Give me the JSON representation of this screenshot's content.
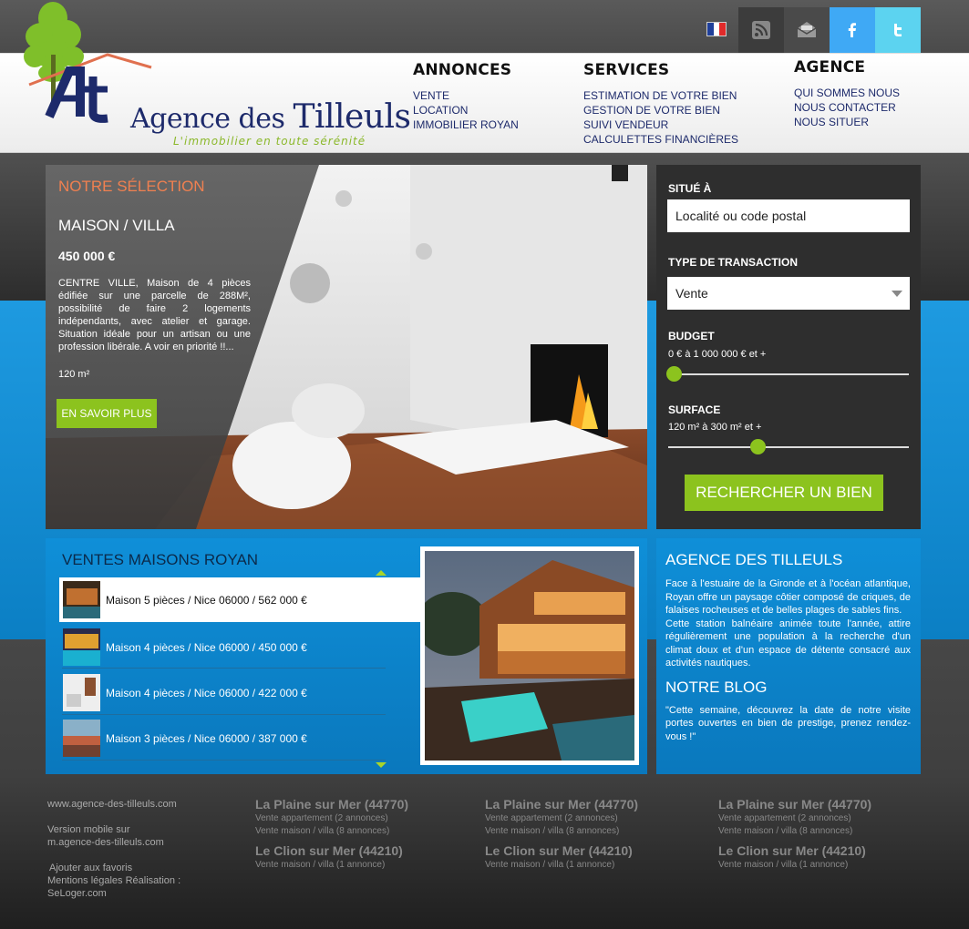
{
  "colors": {
    "accent_green": "#8cc31e",
    "blue": "#1493dc",
    "dark": "#2e2e2e",
    "title_orange": "#f08050",
    "navy": "#1d2a6b"
  },
  "topbar": {
    "language_icon": "france-flag-icon",
    "icons": [
      "rss-icon",
      "mail-icon",
      "facebook-icon",
      "twitter-icon"
    ]
  },
  "logo": {
    "part1": "Agence des ",
    "part2": "Tilleuls",
    "tagline": "L'immobilier en toute sérénité"
  },
  "nav": {
    "annonces": {
      "title": "ANNONCES",
      "items": [
        "VENTE",
        "LOCATION",
        "IMMOBILIER ROYAN"
      ]
    },
    "services": {
      "title": "SERVICES",
      "items": [
        "ESTIMATION DE VOTRE BIEN",
        "GESTION DE  VOTRE BIEN",
        "SUIVI VENDEUR",
        "CALCULETTES FINANCIÈRES"
      ]
    },
    "agence": {
      "title": "AGENCE",
      "items": [
        "QUI SOMMES NOUS",
        "NOUS CONTACTER",
        "NOUS SITUER"
      ]
    }
  },
  "selection": {
    "title": "NOTRE SÉLECTION",
    "type": "MAISON / VILLA",
    "price": "450 000 €",
    "description": "CENTRE VILLE, Maison de 4 pièces édifiée sur une parcelle de 288M², possibilité de faire 2 logements indépendants, avec atelier et garage. Situation idéale pour un artisan ou une profession libérale. A voir en priorité !!...",
    "area": "120 m²",
    "button": "EN SAVOIR PLUS"
  },
  "search": {
    "location_label": "SITUÉ À",
    "location_placeholder": "Localité ou code postal",
    "transaction_label": "TYPE DE TRANSACTION",
    "transaction_value": "Vente",
    "budget_label": "BUDGET",
    "budget_range": "0 € à 1 000 000 € et +",
    "budget_slider_fraction": 0.0,
    "surface_label": "SURFACE",
    "surface_range": "120 m² à 300 m² et +",
    "surface_slider_fraction": 0.35,
    "button": "RECHERCHER UN BIEN"
  },
  "ventes": {
    "title": "VENTES MAISONS ROYAN",
    "items": [
      "Maison 5 pièces / Nice 06000 / 562 000 €",
      "Maison 4 pièces / Nice 06000 / 450 000 €",
      "Maison 4 pièces / Nice 06000 / 422 000 €",
      "Maison 3 pièces / Nice 06000 / 387 000 €"
    ]
  },
  "agence": {
    "title": "AGENCE DES TILLEULS",
    "text1": "Face à l'estuaire de la Gironde et à l'océan atlantique, Royan offre un paysage côtier composé de criques, de falaises rocheuses et de belles plages de sables fins.",
    "text2": "Cette station balnéaire animée toute l'année, attire régulièrement une population à la recherche d'un climat doux et d'un espace de détente consacré aux activités nautiques.",
    "blog_title": "NOTRE BLOG",
    "blog_text": "\"Cette semaine, découvrez la date de notre visite portes ouvertes en bien de prestige, prenez rendez-vous !\""
  },
  "footer": {
    "site": "www.agence-des-tilleuls.com",
    "mobile1": "Version mobile sur",
    "mobile2": "m.agence-des-tilleuls.com",
    "favoris": "Ajouter aux favoris",
    "mentions": "Mentions légales Réalisation :",
    "seloger": "SeLoger.com",
    "columns": [
      {
        "city1": "La Plaine sur Mer (44770)",
        "l1": "Vente appartement (2 annonces)",
        "l2": "Vente maison / villa (8 annonces)",
        "city2": "Le Clion sur Mer (44210)",
        "l3": "Vente maison / villa (1 annonce)"
      },
      {
        "city1": "La Plaine sur Mer (44770)",
        "l1": "Vente appartement (2 annonces)",
        "l2": "Vente maison / villa (8 annonces)",
        "city2": "Le Clion sur Mer (44210)",
        "l3": "Vente maison / villa (1 annonce)"
      },
      {
        "city1": "La Plaine sur Mer (44770)",
        "l1": "Vente appartement (2 annonces)",
        "l2": "Vente maison / villa (8 annonces)",
        "city2": "Le Clion sur Mer (44210)",
        "l3": "Vente maison / villa (1 annonce)"
      }
    ]
  }
}
